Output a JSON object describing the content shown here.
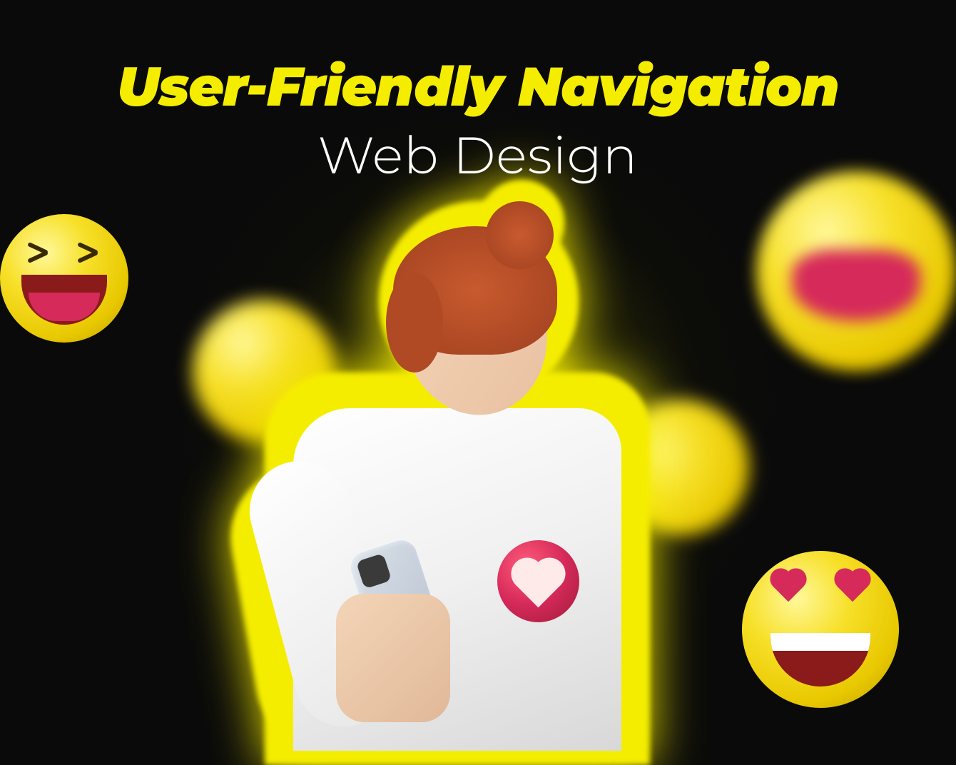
{
  "heading": {
    "title": "User-Friendly Navigation",
    "subtitle": "Web Design"
  },
  "colors": {
    "accent": "#f5ed00",
    "background": "#0a0a0a",
    "text_primary": "#ffffff"
  },
  "graphics": {
    "emojis": [
      "laughing",
      "dizzy",
      "wow",
      "rofl",
      "heart-eyes",
      "heart-react"
    ],
    "subject": "woman-with-phone-smiling"
  }
}
